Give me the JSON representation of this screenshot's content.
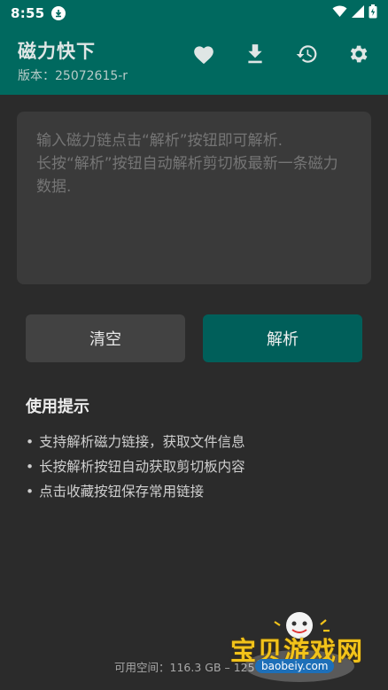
{
  "status": {
    "time": "8:55"
  },
  "app": {
    "title": "磁力快下",
    "version": "版本：25072615-r"
  },
  "icons": {
    "favorite": "heart-icon",
    "download": "download-icon",
    "history": "history-icon",
    "settings": "gear-icon"
  },
  "input": {
    "placeholder": "输入磁力链点击“解析”按钮即可解析.\n长按“解析”按钮自动解析剪切板最新一条磁力数据."
  },
  "buttons": {
    "clear": "清空",
    "parse": "解析"
  },
  "tips": {
    "title": "使用提示",
    "items": [
      "支持解析磁力链接，获取文件信息",
      "长按解析按钮自动获取剪切板内容",
      "点击收藏按钮保存常用链接"
    ]
  },
  "storage": {
    "text": "可用空间：116.3 GB – 125"
  },
  "watermark": {
    "text": "宝贝游戏网",
    "url": "baobeiy.com"
  },
  "colors": {
    "primary": "#00695f",
    "background": "#2b2b2b",
    "surface": "#3a3a3a",
    "accent_button": "#005f5a"
  }
}
